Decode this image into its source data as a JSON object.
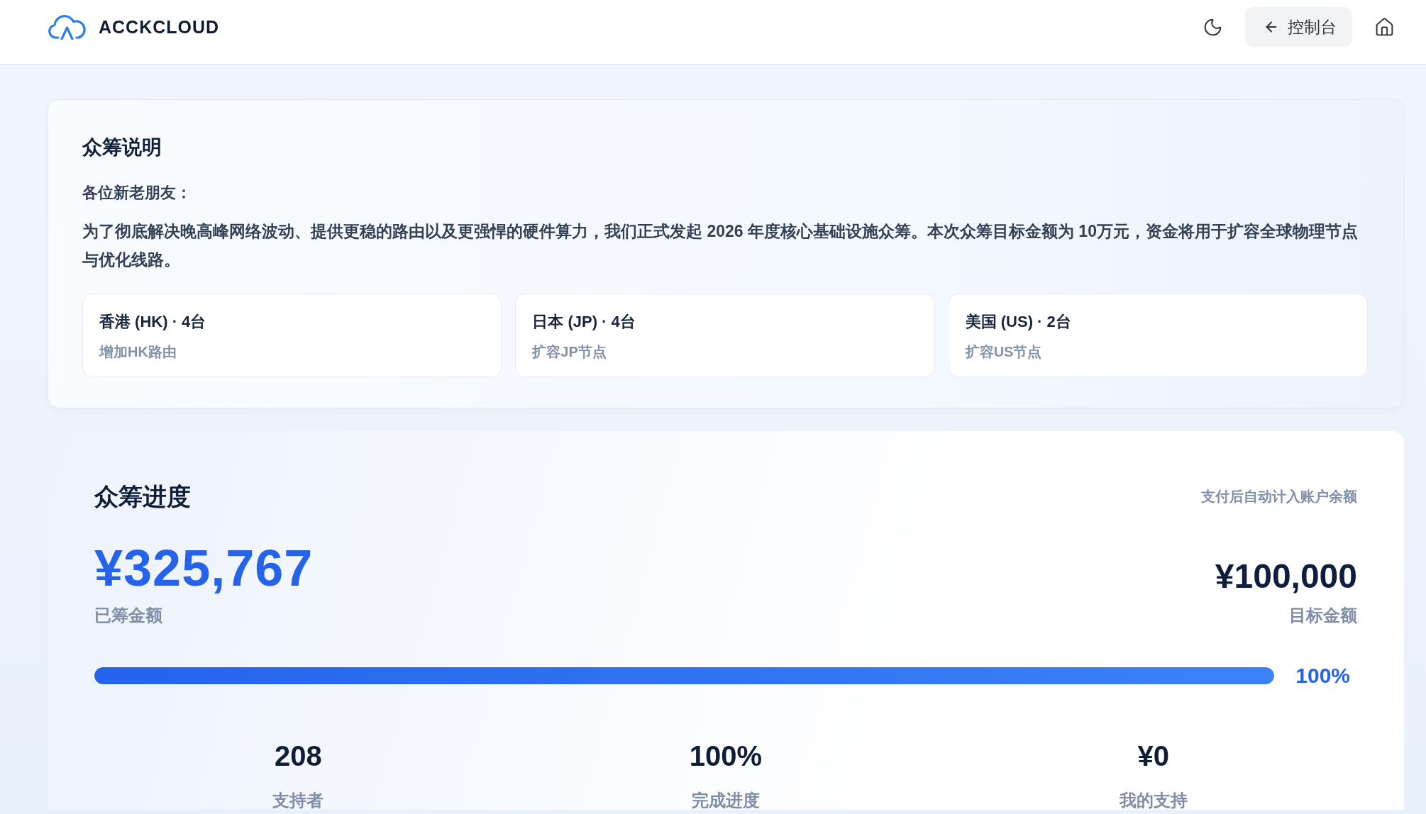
{
  "header": {
    "brand": "ACCKCLOUD",
    "console_button": "控制台"
  },
  "intro": {
    "title": "众筹说明",
    "greeting": "各位新老朋友：",
    "body": "为了彻底解决晚高峰网络波动、提供更稳的路由以及更强悍的硬件算力，我们正式发起 2026 年度核心基础设施众筹。本次众筹目标金额为 10万元，资金将用于扩容全球物理节点与优化线路。",
    "regions": [
      {
        "title": "香港 (HK) · 4台",
        "note": "增加HK路由"
      },
      {
        "title": "日本 (JP) · 4台",
        "note": "扩容JP节点"
      },
      {
        "title": "美国 (US) · 2台",
        "note": "扩容US节点"
      }
    ]
  },
  "progress": {
    "title": "众筹进度",
    "note": "支付后自动计入账户余额",
    "raised": {
      "amount": "¥325,767",
      "label": "已筹金额"
    },
    "goal": {
      "amount": "¥100,000",
      "label": "目标金额"
    },
    "bar": {
      "level": 1,
      "reading": "100%"
    },
    "stats": [
      {
        "value": "208",
        "label": "支持者"
      },
      {
        "value": "100%",
        "label": "完成进度"
      },
      {
        "value": "¥0",
        "label": "我的支持"
      }
    ]
  }
}
